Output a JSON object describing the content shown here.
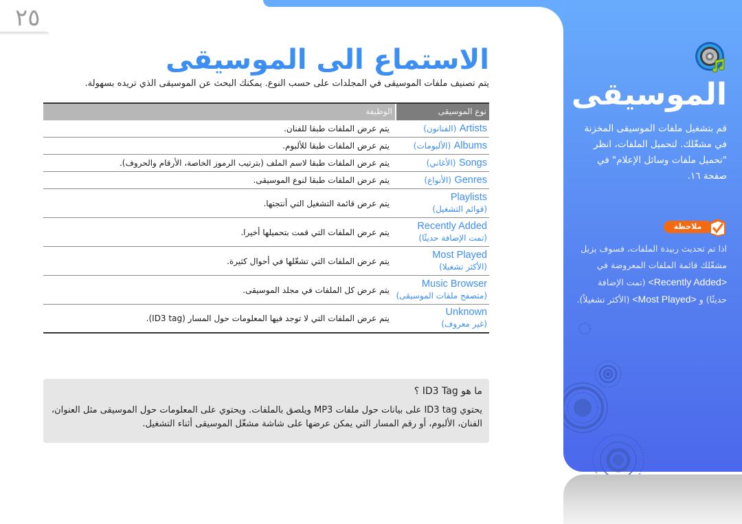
{
  "page": {
    "number": "٢٥",
    "title": "الاستماع الى الموسيقى",
    "intro": "يتم تصنيف ملفات الموسيقى في المجلدات على حسب النوع. يمكنك البحث عن الموسيقى الذي تريده بسهولة."
  },
  "table": {
    "headers": {
      "type": "نوع الموسيقى",
      "function": "الوظيفة"
    },
    "rows": [
      {
        "en": "Artists",
        "ar": "(الفنانون)",
        "desc": "يتم عرض الملفات طبقا للفنان."
      },
      {
        "en": "Albums",
        "ar": "(الألبومات)",
        "desc": "يتم عرض الملفات طبقا للألبوم."
      },
      {
        "en": "Songs",
        "ar": "(الأغاني)",
        "desc": "يتم عرض الملفات طبقا لاسم الملف (بترتيب الرموز الخاصة، الأرقام والحروف)."
      },
      {
        "en": "Genres",
        "ar": "(الأنواع)",
        "desc": "يتم عرض الملفات طبقا لنوع الموسيقى."
      },
      {
        "en": "Playlists",
        "ar": "(قوائم التشغيل)",
        "desc": "يتم عرض قائمة التشغيل التي أنتجتها."
      },
      {
        "en": "Recently Added",
        "ar": "(تمت الإضافة حديثًا)",
        "desc": "يتم عرض الملفات التي قمت بتحميلها أخيرا."
      },
      {
        "en": "Most Played",
        "ar": "(الأكثر تشغيلا)",
        "desc": "يتم عرض الملفات التي تشغّلها في أحوال كثيرة."
      },
      {
        "en": "Music Browser",
        "ar": "(متصفح ملفات الموسيقى)",
        "desc": "يتم عرض كل الملفات في مجلد الموسيقى."
      },
      {
        "en": "Unknown",
        "ar": "(غير معروف)",
        "desc": "يتم عرض الملفات التي لا توجد فيها المعلومات حول المسار (ID3 tag)."
      }
    ]
  },
  "id3_box": {
    "title": "ما هو ID3 Tag ؟",
    "body": "يحتوي ID3 tag على بيانات حول ملفات MP3 ويلصق بالملفات. ويحتوي على المعلومات حول الموسيقى مثل العنوان، الفنان، الألبوم، أو رقم المسار التي يمكن عرضها على شاشة مشغّل الموسيقى أثناء التشغيل."
  },
  "sidebar": {
    "icon": "speaker-music-icon",
    "title": "الموسيقى",
    "description": "قم بتشغيل ملفات الموسيقى المخزنة في مشغّلك. لتحميل الملفات، انظر \"تحميل ملفات وسائل الإعلام\" في صفحة ١٦.",
    "note_label": "ملاحظة",
    "note_text_1": "اذا تم تحديث ربيدة الملفات، فسوف يزيل مشغّلك قائمة الملفات المعروضة في ",
    "note_en_1": "<Recently Added>",
    "note_text_2": " (تمت الإضافة حديثًا) و ",
    "note_en_2": "<Most Played>",
    "note_text_3": " (الأكثر تشغيلاً)."
  },
  "colors": {
    "accent_blue": "#3d8ef2",
    "panel_blue": "#5f97f6",
    "note_orange": "#f46a12",
    "header_dark": "#7d7d7d",
    "header_light": "#b7b7b7",
    "box_gray": "#e6e6e6"
  }
}
